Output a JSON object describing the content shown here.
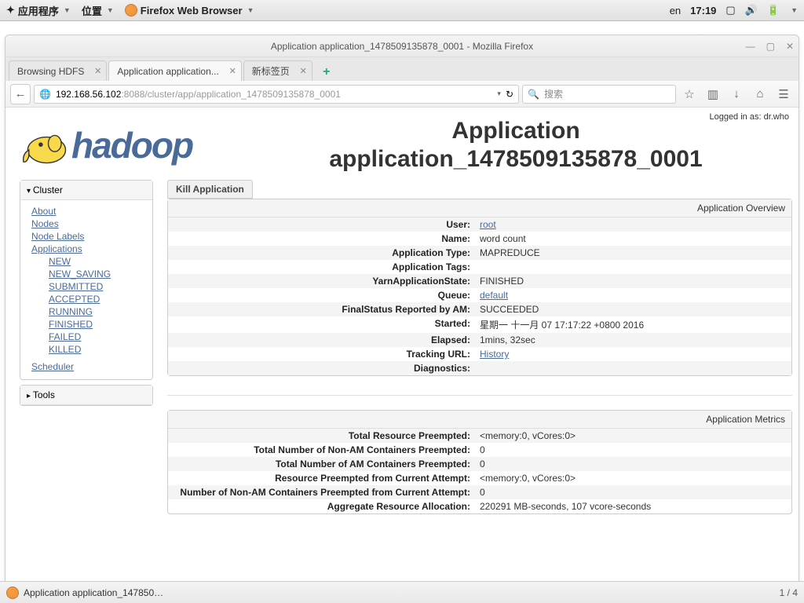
{
  "gnome": {
    "apps": "应用程序",
    "places": "位置",
    "firefox": "Firefox Web Browser",
    "lang": "en",
    "time": "17:19"
  },
  "window_title": "Application application_1478509135878_0001 - Mozilla Firefox",
  "tabs": [
    {
      "label": "Browsing HDFS"
    },
    {
      "label": "Application application..."
    },
    {
      "label": "新标签页"
    }
  ],
  "url_host": "192.168.56.102",
  "url_port": ":8088",
  "url_path": "/cluster/app/application_1478509135878_0001",
  "search_placeholder": "搜索",
  "logged_in": "Logged in as: dr.who",
  "page_heading_l1": "Application",
  "page_heading_l2": "application_1478509135878_0001",
  "sidebar": {
    "cluster_label": "Cluster",
    "cluster_links": [
      "About",
      "Nodes",
      "Node Labels",
      "Applications"
    ],
    "app_states": [
      "NEW",
      "NEW_SAVING",
      "SUBMITTED",
      "ACCEPTED",
      "RUNNING",
      "FINISHED",
      "FAILED",
      "KILLED"
    ],
    "scheduler": "Scheduler",
    "tools_label": "Tools"
  },
  "kill_button": "Kill Application",
  "overview_title": "Application Overview",
  "overview": {
    "k_user": "User:",
    "v_user": "root",
    "k_name": "Name:",
    "v_name": "word count",
    "k_type": "Application Type:",
    "v_type": "MAPREDUCE",
    "k_tags": "Application Tags:",
    "v_tags": "",
    "k_state": "YarnApplicationState:",
    "v_state": "FINISHED",
    "k_queue": "Queue:",
    "v_queue": "default",
    "k_final": "FinalStatus Reported by AM:",
    "v_final": "SUCCEEDED",
    "k_started": "Started:",
    "v_started": "星期一 十一月 07 17:17:22 +0800 2016",
    "k_elapsed": "Elapsed:",
    "v_elapsed": "1mins, 32sec",
    "k_tracking": "Tracking URL:",
    "v_tracking": "History",
    "k_diag": "Diagnostics:",
    "v_diag": ""
  },
  "metrics_title": "Application Metrics",
  "metrics": {
    "k1": "Total Resource Preempted:",
    "v1": "<memory:0, vCores:0>",
    "k2": "Total Number of Non-AM Containers Preempted:",
    "v2": "0",
    "k3": "Total Number of AM Containers Preempted:",
    "v3": "0",
    "k4": "Resource Preempted from Current Attempt:",
    "v4": "<memory:0, vCores:0>",
    "k5": "Number of Non-AM Containers Preempted from Current Attempt:",
    "v5": "0",
    "k6": "Aggregate Resource Allocation:",
    "v6": "220291 MB-seconds, 107 vcore-seconds"
  },
  "taskbar_label": "Application application_147850…",
  "workspace": "1 / 4"
}
